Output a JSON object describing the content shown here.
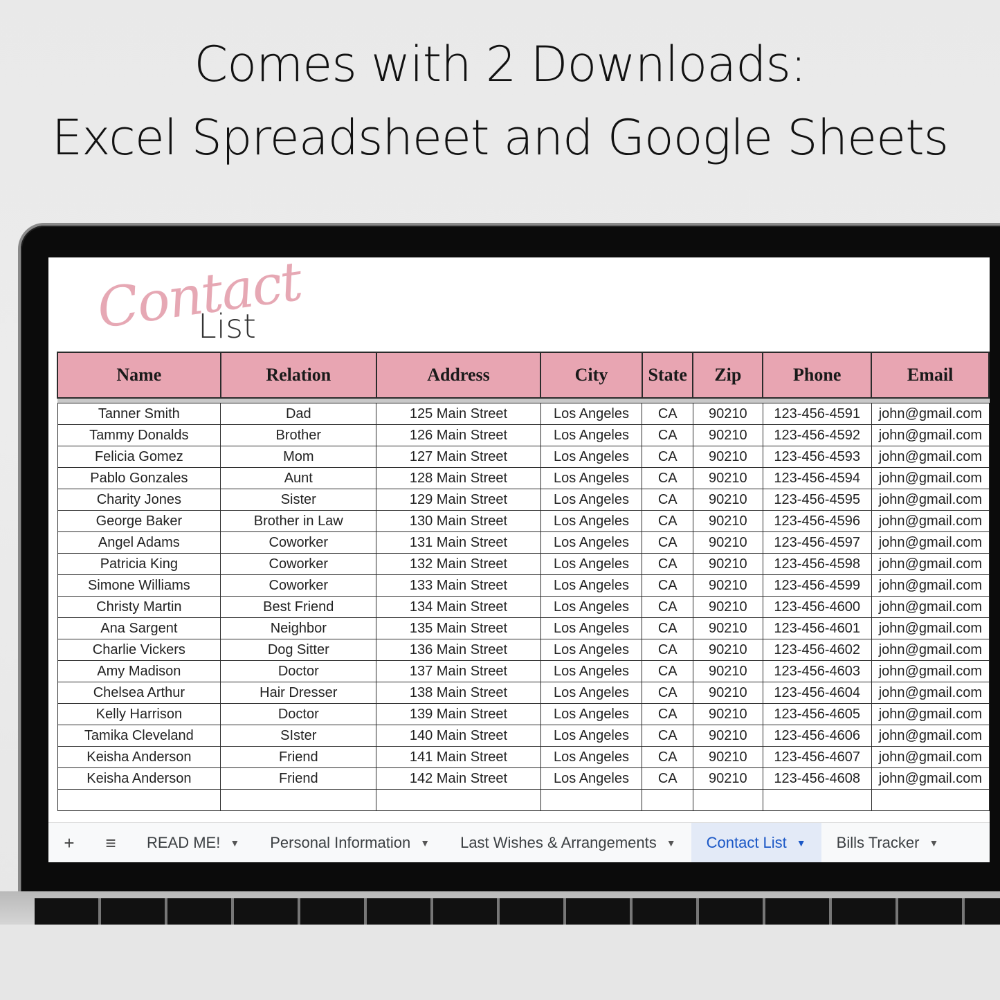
{
  "headline": {
    "line1": "Comes with 2 Downloads:",
    "line2": "Excel Spreadsheet and Google Sheets"
  },
  "logo": {
    "script": "Contact",
    "sub": "List"
  },
  "columns": [
    "Name",
    "Relation",
    "Address",
    "City",
    "State",
    "Zip",
    "Phone",
    "Email"
  ],
  "rows": [
    [
      "Tanner Smith",
      "Dad",
      "125 Main Street",
      "Los Angeles",
      "CA",
      "90210",
      "123-456-4591",
      "john@gmail.com"
    ],
    [
      "Tammy Donalds",
      "Brother",
      "126 Main Street",
      "Los Angeles",
      "CA",
      "90210",
      "123-456-4592",
      "john@gmail.com"
    ],
    [
      "Felicia Gomez",
      "Mom",
      "127 Main Street",
      "Los Angeles",
      "CA",
      "90210",
      "123-456-4593",
      "john@gmail.com"
    ],
    [
      "Pablo Gonzales",
      "Aunt",
      "128 Main Street",
      "Los Angeles",
      "CA",
      "90210",
      "123-456-4594",
      "john@gmail.com"
    ],
    [
      "Charity Jones",
      "Sister",
      "129 Main Street",
      "Los Angeles",
      "CA",
      "90210",
      "123-456-4595",
      "john@gmail.com"
    ],
    [
      "George Baker",
      "Brother in Law",
      "130 Main Street",
      "Los Angeles",
      "CA",
      "90210",
      "123-456-4596",
      "john@gmail.com"
    ],
    [
      "Angel Adams",
      "Coworker",
      "131 Main Street",
      "Los Angeles",
      "CA",
      "90210",
      "123-456-4597",
      "john@gmail.com"
    ],
    [
      "Patricia King",
      "Coworker",
      "132 Main Street",
      "Los Angeles",
      "CA",
      "90210",
      "123-456-4598",
      "john@gmail.com"
    ],
    [
      "Simone Williams",
      "Coworker",
      "133 Main Street",
      "Los Angeles",
      "CA",
      "90210",
      "123-456-4599",
      "john@gmail.com"
    ],
    [
      "Christy Martin",
      "Best Friend",
      "134 Main Street",
      "Los Angeles",
      "CA",
      "90210",
      "123-456-4600",
      "john@gmail.com"
    ],
    [
      "Ana Sargent",
      "Neighbor",
      "135 Main Street",
      "Los Angeles",
      "CA",
      "90210",
      "123-456-4601",
      "john@gmail.com"
    ],
    [
      "Charlie Vickers",
      "Dog Sitter",
      "136 Main Street",
      "Los Angeles",
      "CA",
      "90210",
      "123-456-4602",
      "john@gmail.com"
    ],
    [
      "Amy Madison",
      "Doctor",
      "137 Main Street",
      "Los Angeles",
      "CA",
      "90210",
      "123-456-4603",
      "john@gmail.com"
    ],
    [
      "Chelsea Arthur",
      "Hair Dresser",
      "138 Main Street",
      "Los Angeles",
      "CA",
      "90210",
      "123-456-4604",
      "john@gmail.com"
    ],
    [
      "Kelly Harrison",
      "Doctor",
      "139 Main Street",
      "Los Angeles",
      "CA",
      "90210",
      "123-456-4605",
      "john@gmail.com"
    ],
    [
      "Tamika Cleveland",
      "SIster",
      "140 Main Street",
      "Los Angeles",
      "CA",
      "90210",
      "123-456-4606",
      "john@gmail.com"
    ],
    [
      "Keisha Anderson",
      "Friend",
      "141 Main Street",
      "Los Angeles",
      "CA",
      "90210",
      "123-456-4607",
      "john@gmail.com"
    ],
    [
      "Keisha Anderson",
      "Friend",
      "142 Main Street",
      "Los Angeles",
      "CA",
      "90210",
      "123-456-4608",
      "john@gmail.com"
    ]
  ],
  "tabbar": {
    "add_icon": "+",
    "menu_icon": "≡",
    "caret": "▼",
    "tabs": [
      {
        "label": "READ ME!",
        "active": false
      },
      {
        "label": "Personal Information",
        "active": false
      },
      {
        "label": "Last Wishes & Arrangements",
        "active": false
      },
      {
        "label": "Contact List",
        "active": true
      },
      {
        "label": "Bills Tracker",
        "active": false
      }
    ]
  },
  "colors": {
    "header_pink": "#e8a5b2",
    "active_tab_text": "#1a57c6",
    "active_tab_bg": "#e3eaf7"
  }
}
